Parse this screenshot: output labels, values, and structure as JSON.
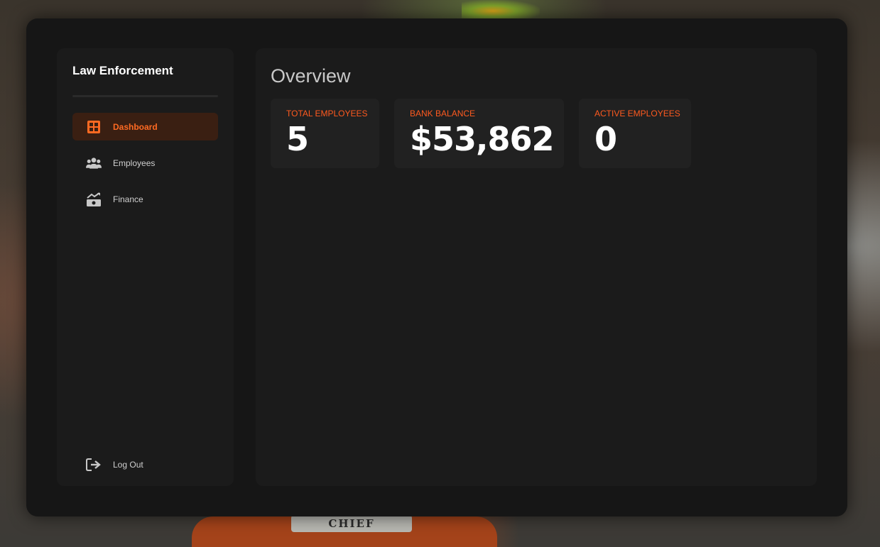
{
  "app": {
    "title": "Law Enforcement",
    "accent_color": "#ff5a1f"
  },
  "sidebar": {
    "items": [
      {
        "label": "Dashboard",
        "icon": "dashboard-grid-icon",
        "active": true
      },
      {
        "label": "Employees",
        "icon": "users-icon",
        "active": false
      },
      {
        "label": "Finance",
        "icon": "finance-chart-icon",
        "active": false
      }
    ],
    "logout": {
      "label": "Log Out",
      "icon": "logout-icon"
    }
  },
  "main": {
    "title": "Overview",
    "cards": [
      {
        "label": "TOTAL EMPLOYEES",
        "value": "5"
      },
      {
        "label": "BANK BALANCE",
        "value": "$53,862"
      },
      {
        "label": "ACTIVE EMPLOYEES",
        "value": "0"
      }
    ]
  }
}
